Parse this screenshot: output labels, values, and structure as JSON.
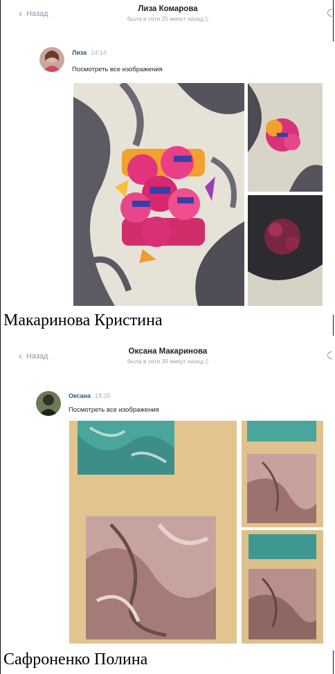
{
  "conversations": [
    {
      "back_label": "Назад",
      "chat_title": "Лиза Комарова",
      "chat_status": "была в сети 25 минут назад",
      "sender": "Лиза",
      "time": "14:14",
      "see_all": "Посмотреть все изображения",
      "caption": "Макаринова Кристина"
    },
    {
      "back_label": "Назад",
      "chat_title": "Оксана Макаринова",
      "chat_status": "была в сети 39 минут назад",
      "sender": "Оксана",
      "time": "18:35",
      "see_all": "Посмотреть все изображения",
      "caption": "Сафроненко Полина"
    }
  ],
  "icons": {
    "back": "chevron-left-icon",
    "search": "search-icon",
    "status": "phone-icon"
  },
  "colors": {
    "link_blue": "#2a5885",
    "muted_gray": "#8a96a3"
  }
}
